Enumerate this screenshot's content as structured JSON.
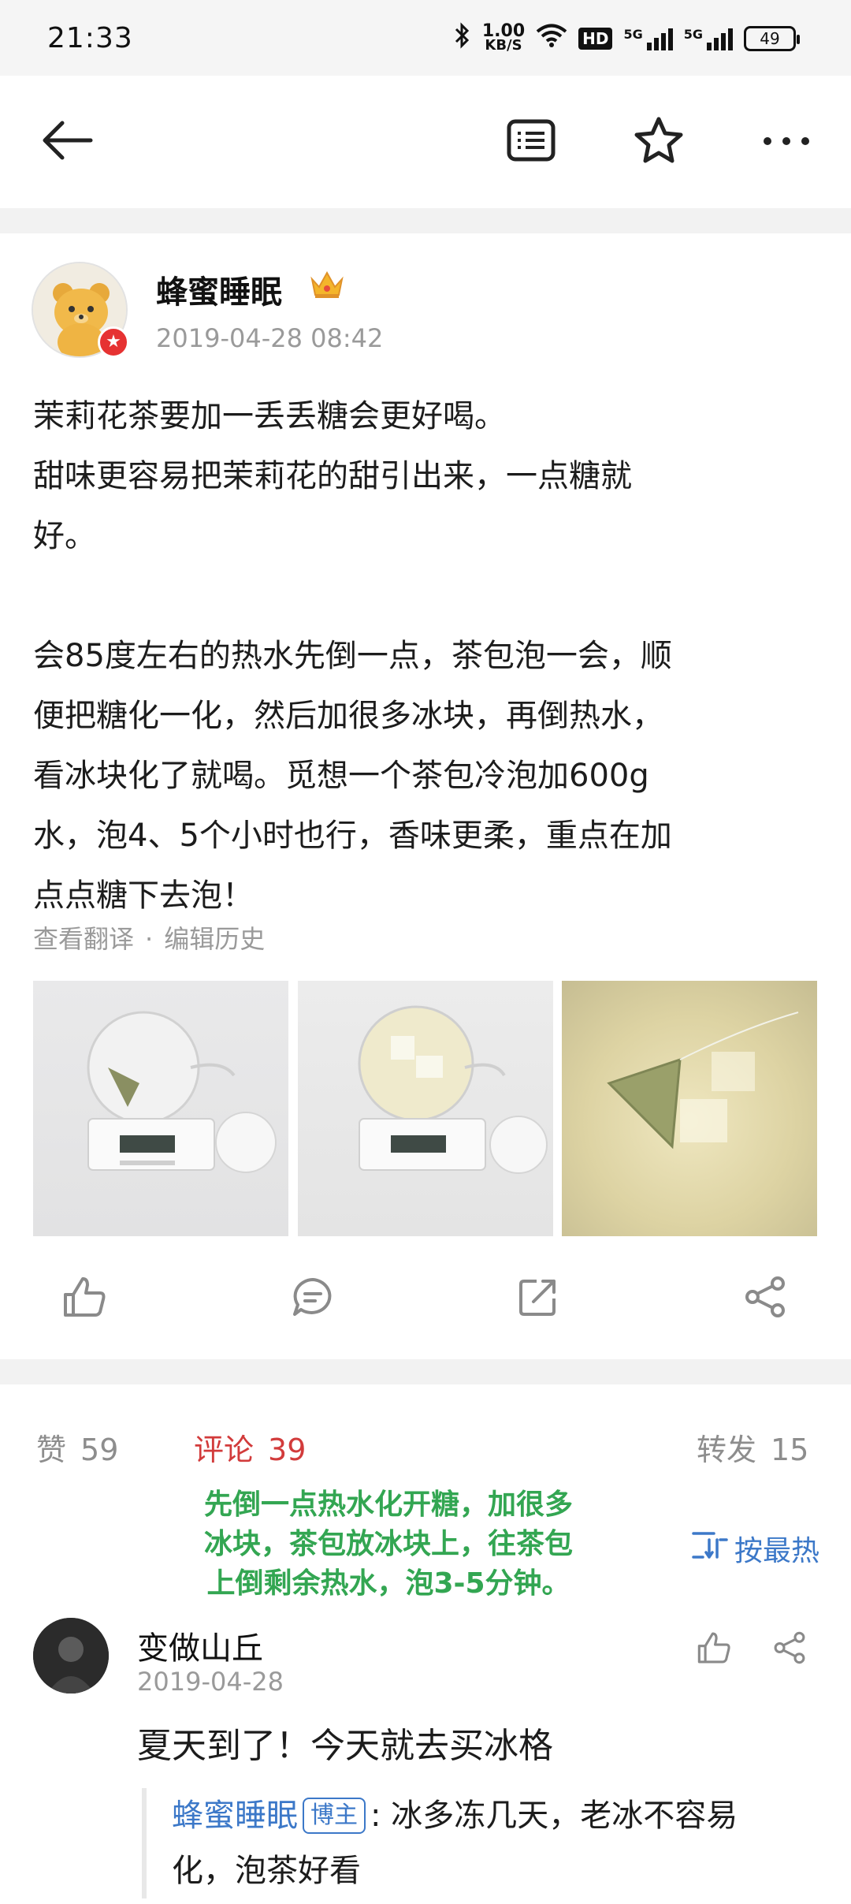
{
  "status_bar": {
    "time": "21:33",
    "net_speed_value": "1.00",
    "net_speed_unit": "KB/S",
    "hd_label": "HD",
    "signal1_label": "5G",
    "signal2_label": "5G",
    "battery": "49"
  },
  "post": {
    "author": "蜂蜜睡眠",
    "timestamp": "2019-04-28 08:42",
    "paragraphs": [
      "茉莉花茶要加一丢丢糖会更好喝。",
      "甜味更容易把茉莉花的甜引出来，一点糖就",
      "好。",
      "",
      "会85度左右的热水先倒一点，茶包泡一会，顺",
      "便把糖化一化，然后加很多冰块，再倒热水，",
      "看冰块化了就喝。觅想一个茶包冷泡加600g",
      "水，泡4、5个小时也行，香味更柔，重点在加",
      "点点糖下去泡！"
    ],
    "translate_link": "查看翻译",
    "meta_separator": "·",
    "edit_history_link": "编辑历史"
  },
  "stats": {
    "likes_label": "赞",
    "likes_count": "59",
    "comments_label": "评论",
    "comments_count": "39",
    "reposts_label": "转发",
    "reposts_count": "15"
  },
  "overlay_note": {
    "lines": [
      "先倒一点热水化开糖，加很多",
      "冰块，茶包放冰块上，往茶包",
      "上倒剩余热水，泡3-5分钟。"
    ]
  },
  "sort": {
    "label": "按最热"
  },
  "comment": {
    "author": "变做山丘",
    "timestamp": "2019-04-28",
    "text": "夏天到了！今天就去买冰格",
    "reply": {
      "author": "蜂蜜睡眠",
      "tag": "博主",
      "text_line1": ": 冰多冻几天，老冰不容易",
      "text_line2": "化，泡茶好看"
    }
  },
  "colors": {
    "accent_blue": "#3c78c8",
    "comment_red": "#d23b3b",
    "note_green": "#33a652",
    "muted_gray": "#9a9a9a"
  }
}
